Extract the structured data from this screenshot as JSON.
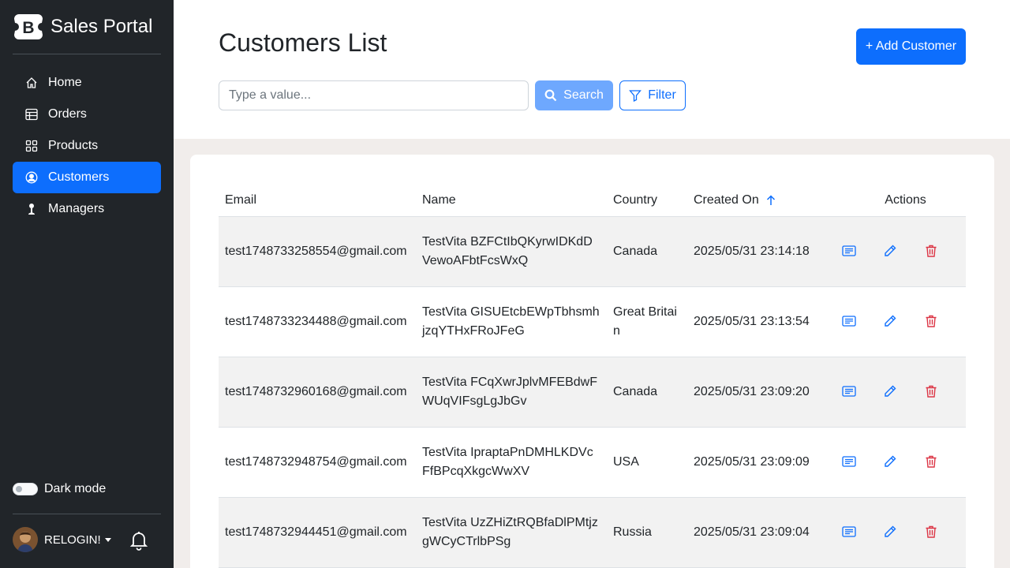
{
  "app": {
    "name": "Sales Portal",
    "logo_letter": "B"
  },
  "sidebar": {
    "items": [
      {
        "label": "Home",
        "icon": "house-icon",
        "active": false
      },
      {
        "label": "Orders",
        "icon": "table-icon",
        "active": false
      },
      {
        "label": "Products",
        "icon": "grid-icon",
        "active": false
      },
      {
        "label": "Customers",
        "icon": "person-circle-icon",
        "active": true
      },
      {
        "label": "Managers",
        "icon": "manager-icon",
        "active": false
      }
    ],
    "dark_mode_label": "Dark mode",
    "dark_mode_on": false,
    "user_name": "RELOGIN!"
  },
  "header": {
    "title": "Customers List",
    "add_button": "+ Add Customer",
    "search_placeholder": "Type a value...",
    "search_button": "Search",
    "filter_button": "Filter"
  },
  "table": {
    "columns": [
      "Email",
      "Name",
      "Country",
      "Created On",
      "Actions"
    ],
    "sorted_column": "Created On",
    "sort_direction": "ascending",
    "rows": [
      {
        "email": "test1748733258554@gmail.com",
        "name": "TestVita BZFCtIbQKyrwIDKdDVewoAFbtFcsWxQ",
        "country": "Canada",
        "created": "2025/05/31 23:14:18"
      },
      {
        "email": "test1748733234488@gmail.com",
        "name": "TestVita GISUEtcbEWpTbhsmhjzqYTHxFRoJFeG",
        "country": "Great Britain",
        "created": "2025/05/31 23:13:54"
      },
      {
        "email": "test1748732960168@gmail.com",
        "name": "TestVita FCqXwrJplvMFEBdwFWUqVIFsgLgJbGv",
        "country": "Canada",
        "created": "2025/05/31 23:09:20"
      },
      {
        "email": "test1748732948754@gmail.com",
        "name": "TestVita IpraptaPnDMHLKDVcFfBPcqXkgcWwXV",
        "country": "USA",
        "created": "2025/05/31 23:09:09"
      },
      {
        "email": "test1748732944451@gmail.com",
        "name": "TestVita UzZHiZtRQBfaDlPMtjzgWCyCTrlbPSg",
        "country": "Russia",
        "created": "2025/05/31 23:09:04"
      }
    ]
  },
  "colors": {
    "primary": "#0d6efd",
    "danger": "#dc3545",
    "sidebar_bg": "#212529"
  }
}
